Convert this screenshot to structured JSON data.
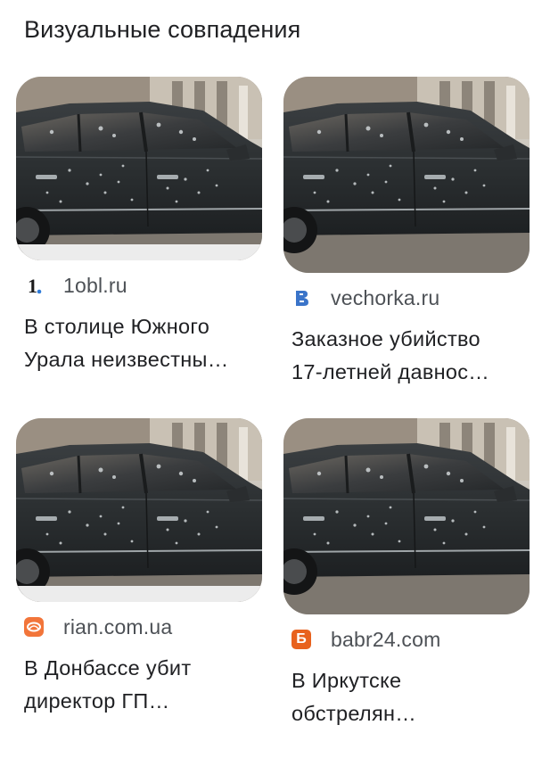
{
  "section": {
    "title": "Визуальные совпадения"
  },
  "results": [
    {
      "source": "1obl.ru",
      "favicon": "1obl-logo-icon",
      "favicon_text": "1",
      "caption_line1": "В столице Южного",
      "caption_line2": "Урала неизвестны…"
    },
    {
      "source": "vechorka.ru",
      "favicon": "vechorka-logo-icon",
      "favicon_text": "В",
      "caption_line1": "Заказное убийство",
      "caption_line2": "17-летней давнос…"
    },
    {
      "source": "rian.com.ua",
      "favicon": "rian-logo-icon",
      "favicon_text": "",
      "caption_line1": "В Донбассе убит",
      "caption_line2": "директор ГП…"
    },
    {
      "source": "babr24.com",
      "favicon": "babr24-logo-icon",
      "favicon_text": "Б",
      "caption_line1": "В Иркутске",
      "caption_line2": "обстрелян…"
    }
  ],
  "colors": {
    "rian": "#f2753a",
    "babr": "#e8621e",
    "vechorka": "#3a74c9",
    "obl": "#1a1a1a"
  }
}
